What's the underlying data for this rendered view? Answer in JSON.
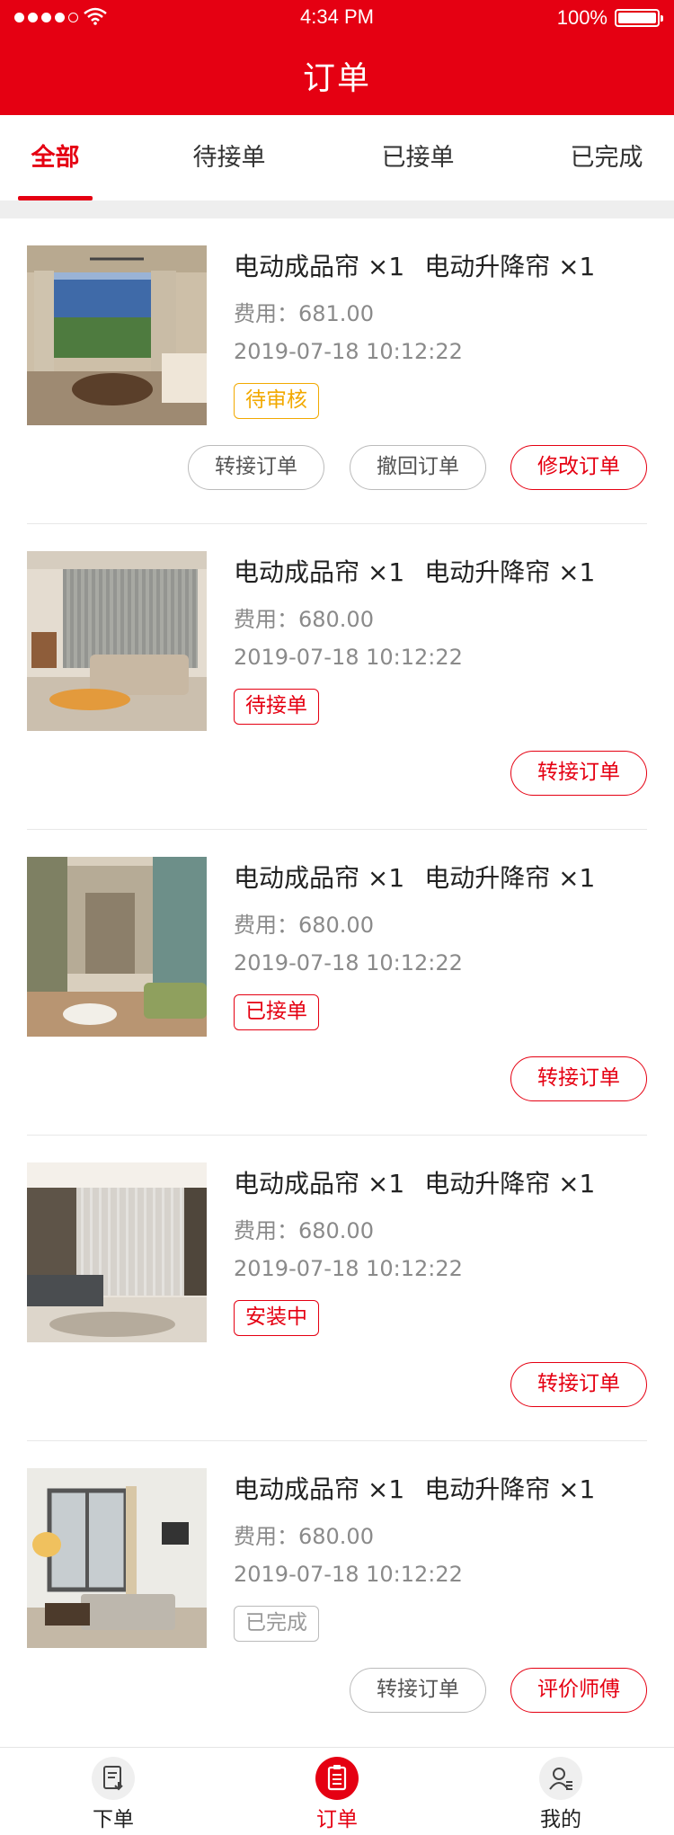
{
  "status_bar": {
    "time": "4:34 PM",
    "battery": "100%"
  },
  "header": {
    "title": "订单"
  },
  "tabs": [
    {
      "label": "全部",
      "active": true
    },
    {
      "label": "待接单"
    },
    {
      "label": "已接单"
    },
    {
      "label": "已完成"
    }
  ],
  "orders": [
    {
      "item1": "电动成品帘 ×1",
      "item2": "电动升降帘 ×1",
      "fee": "费用：681.00",
      "date": "2019-07-18 10:12:22",
      "status": "待审核",
      "status_color": "#f2a900",
      "buttons": [
        "转接订单",
        "撤回订单",
        "修改订单"
      ]
    },
    {
      "item1": "电动成品帘 ×1",
      "item2": "电动升降帘 ×1",
      "fee": "费用：680.00",
      "date": "2019-07-18 10:12:22",
      "status": "待接单",
      "status_color": "#e50012",
      "buttons": [
        "转接订单"
      ]
    },
    {
      "item1": "电动成品帘 ×1",
      "item2": "电动升降帘 ×1",
      "fee": "费用：680.00",
      "date": "2019-07-18 10:12:22",
      "status": "已接单",
      "status_color": "#e50012",
      "buttons": [
        "转接订单"
      ]
    },
    {
      "item1": "电动成品帘 ×1",
      "item2": "电动升降帘 ×1",
      "fee": "费用：680.00",
      "date": "2019-07-18 10:12:22",
      "status": "安装中",
      "status_color": "#e50012",
      "buttons": [
        "转接订单"
      ]
    },
    {
      "item1": "电动成品帘 ×1",
      "item2": "电动升降帘 ×1",
      "fee": "费用：680.00",
      "date": "2019-07-18 10:12:22",
      "status": "已完成",
      "status_color": "#999999",
      "buttons": [
        "转接订单",
        "评价师傅"
      ]
    }
  ],
  "bottom_nav": [
    {
      "label": "下单",
      "icon": "order-form-icon"
    },
    {
      "label": "订单",
      "icon": "orders-list-icon",
      "active": true
    },
    {
      "label": "我的",
      "icon": "profile-icon"
    }
  ],
  "colors": {
    "brand": "#e50012",
    "pending_review": "#f2a900",
    "muted": "#8a8a8a"
  }
}
